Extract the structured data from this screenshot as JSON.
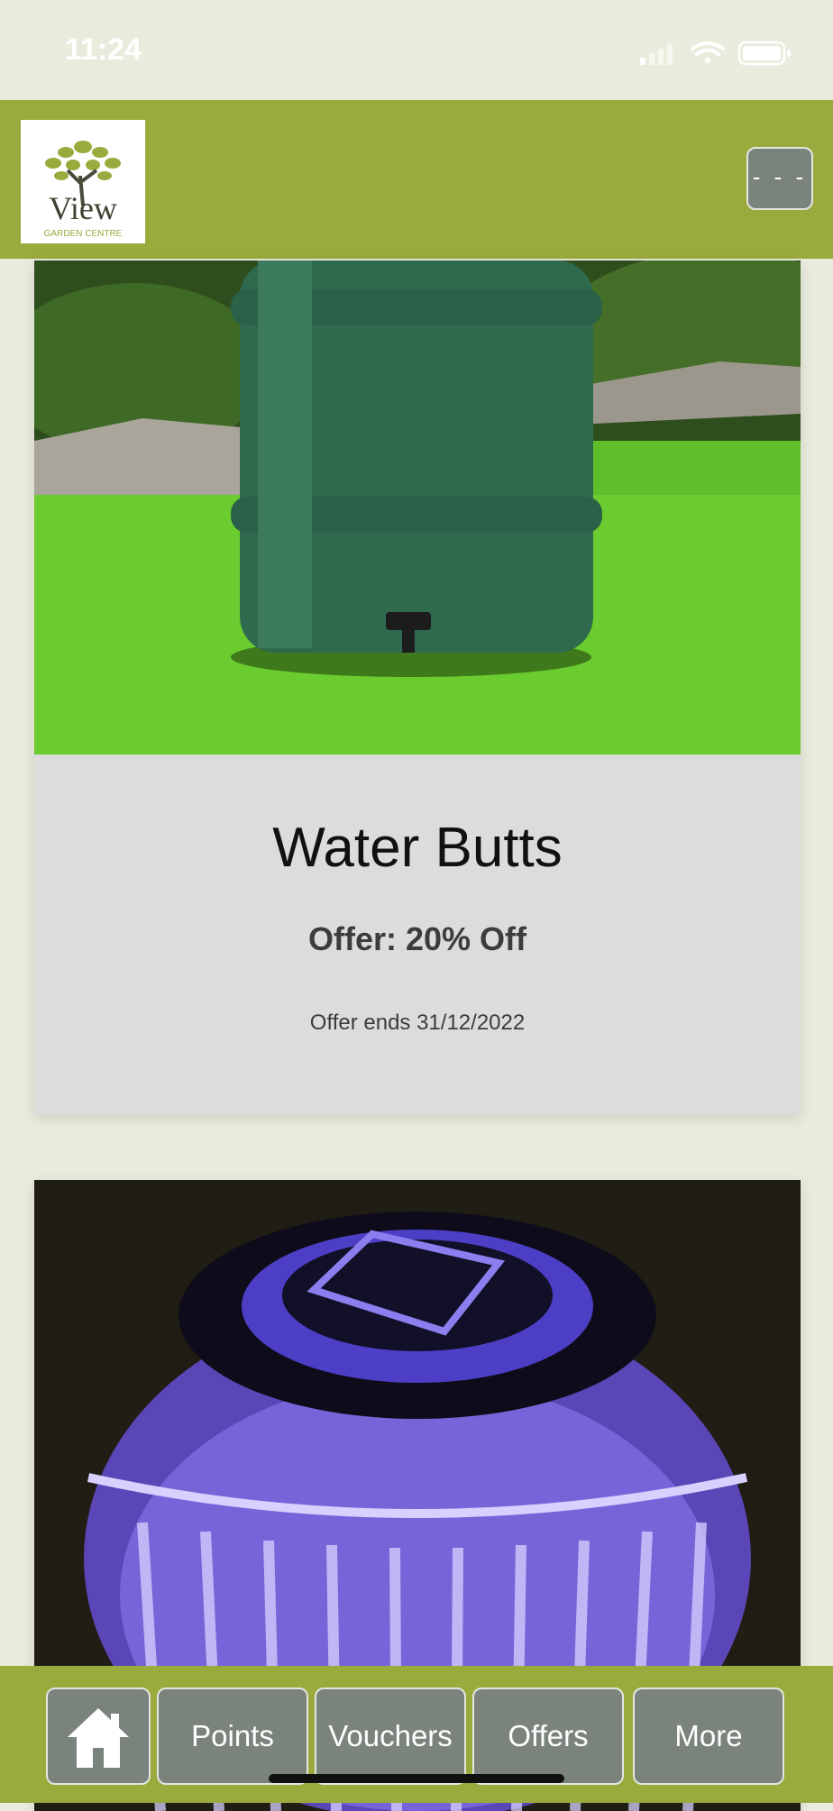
{
  "status_bar": {
    "time": "11:24"
  },
  "header": {
    "logo_text": "View",
    "logo_subtext": "GARDEN CENTRE",
    "menu_label": "- - -"
  },
  "offers": [
    {
      "title": "Water Butts",
      "offer": "Offer: 20% Off",
      "ends": "Offer ends 31/12/2022",
      "image_subject": "green water butt on lawn"
    },
    {
      "image_subject": "purple solar lantern"
    }
  ],
  "bottom_nav": {
    "home_icon": "home-icon",
    "points": "Points",
    "vouchers": "Vouchers",
    "offers": "Offers",
    "more": "More"
  },
  "colors": {
    "background": "#e9ecdc",
    "header": "#9aaa3c",
    "button": "#7a847c",
    "card": "#dcdcdc"
  }
}
